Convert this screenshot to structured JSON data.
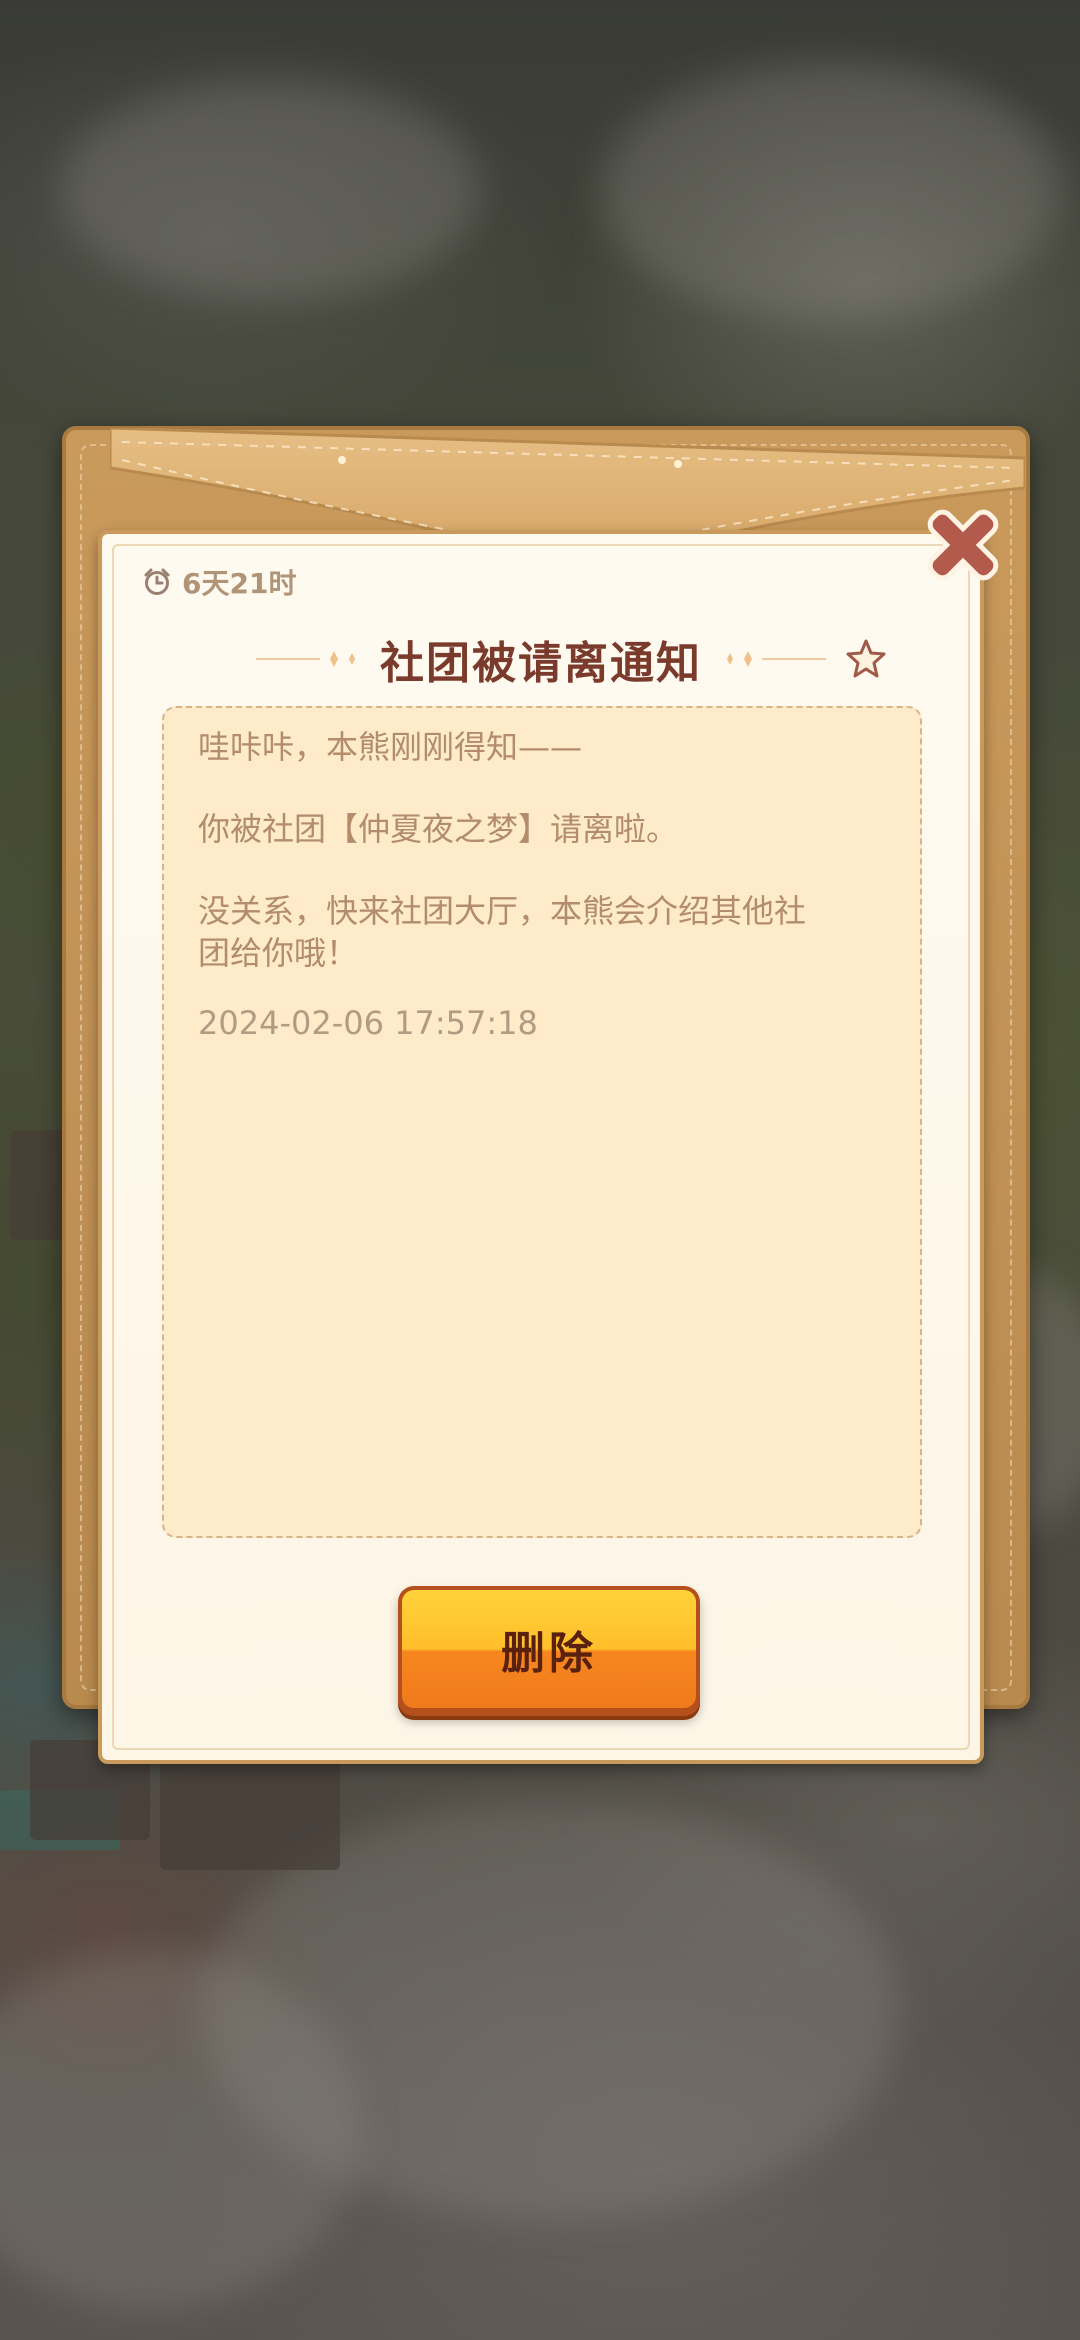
{
  "dialog": {
    "timer_text": "6天21时",
    "title": "社团被请离通知",
    "message": {
      "line1": "哇咔咔，本熊刚刚得知——",
      "line2": "你被社团【仲夏夜之梦】请离啦。",
      "line3a": "没关系，快来社团大厅，本熊会介绍其他社",
      "line3b": "团给你哦！",
      "timestamp": "2024-02-06 17:57:18"
    },
    "delete_label": "删除"
  },
  "icons": {
    "timer": "alarm-clock-icon",
    "favorite": "star-icon",
    "close": "close-icon"
  },
  "colors": {
    "title": "#7a3a2c",
    "message_text": "#b28c6b",
    "button_top": "#ffd23a",
    "button_bottom": "#f07a1c",
    "close": "#b25a4c",
    "envelope": "#c99a5c"
  }
}
